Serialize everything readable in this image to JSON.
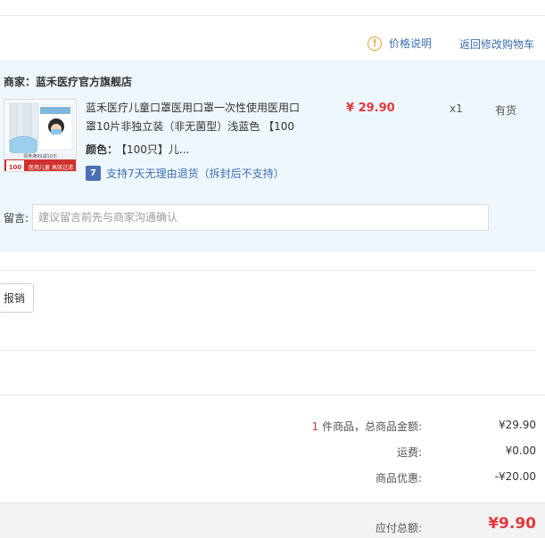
{
  "header": {
    "price_note_label": "价格说明",
    "back_to_cart_label": "返回修改购物车"
  },
  "order": {
    "merchant": "商家：蓝禾医疗官方旗舰店",
    "product_title": "蓝禾医疗儿童口罩医用口罩一次性使用医用口罩10片非独立装（非无菌型）浅蓝色 【100",
    "price": "¥ 29.90",
    "quantity": "x1",
    "stock": "有货",
    "color_label": "颜色：",
    "color_value": "【100只】儿...",
    "return_badge": "7",
    "return_text": "支持7天无理由退货（拆封后不支持）",
    "message_label": "留言:",
    "message_placeholder": "建议留言前先与商家沟通确认",
    "thumb": {
      "label_top": "领券满99减10元",
      "badge": "100",
      "tag": "医用儿童",
      "tag2": "高效过滤"
    }
  },
  "report_button": "报销",
  "summary": {
    "item_count": "1",
    "item_count_suffix": " 件商品，总商品金额:",
    "goods_total": "¥29.90",
    "shipping_label": "运费:",
    "shipping_value": "¥0.00",
    "discount_label": "商品优惠:",
    "discount_value": "-¥20.00",
    "payable_label": "应付总额:",
    "payable_value": "¥9.90"
  },
  "colors": {
    "accent_red": "#e4393c",
    "link_blue": "#3c6fb1",
    "panel_bg": "#eef7fd",
    "warn_orange": "#f0a020"
  }
}
